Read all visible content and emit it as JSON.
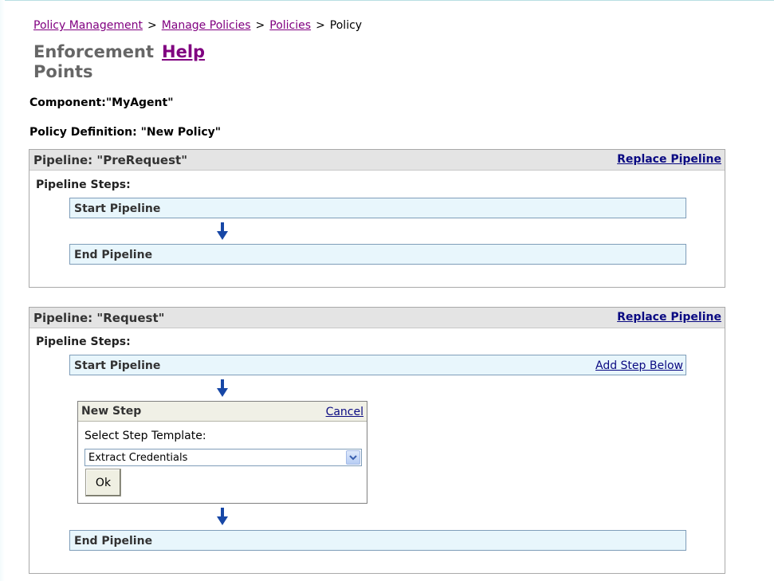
{
  "breadcrumb": {
    "items": [
      "Policy Management",
      "Manage Policies",
      "Policies"
    ],
    "separator": ">",
    "current": "Policy"
  },
  "page": {
    "title": "Enforcement Points",
    "help_label": "Help"
  },
  "component_line": "Component:\"MyAgent\"",
  "policy_line": "Policy Definition: \"New Policy\"",
  "pipelines": [
    {
      "title": "Pipeline: \"PreRequest\"",
      "replace_label": "Replace Pipeline",
      "steps_label": "Pipeline Steps:",
      "start_step": "Start Pipeline",
      "end_step": "End Pipeline"
    },
    {
      "title": "Pipeline: \"Request\"",
      "replace_label": "Replace Pipeline",
      "steps_label": "Pipeline Steps:",
      "start_step": "Start Pipeline",
      "add_step_label": "Add Step Below",
      "end_step": "End Pipeline"
    }
  ],
  "new_step": {
    "title": "New Step",
    "cancel_label": "Cancel",
    "select_label": "Select Step Template:",
    "selected_template": "Extract Credentials",
    "ok_label": "Ok"
  },
  "icons": {
    "flow_arrow": "arrow-down-icon",
    "dropdown": "chevron-down-icon"
  },
  "colors": {
    "link": "#0a0a82",
    "visited_link": "#800080",
    "title_gray": "#666666",
    "header_bg": "#e4e4e4",
    "step_bg": "#e8f6fc",
    "arrow": "#1747a6"
  }
}
